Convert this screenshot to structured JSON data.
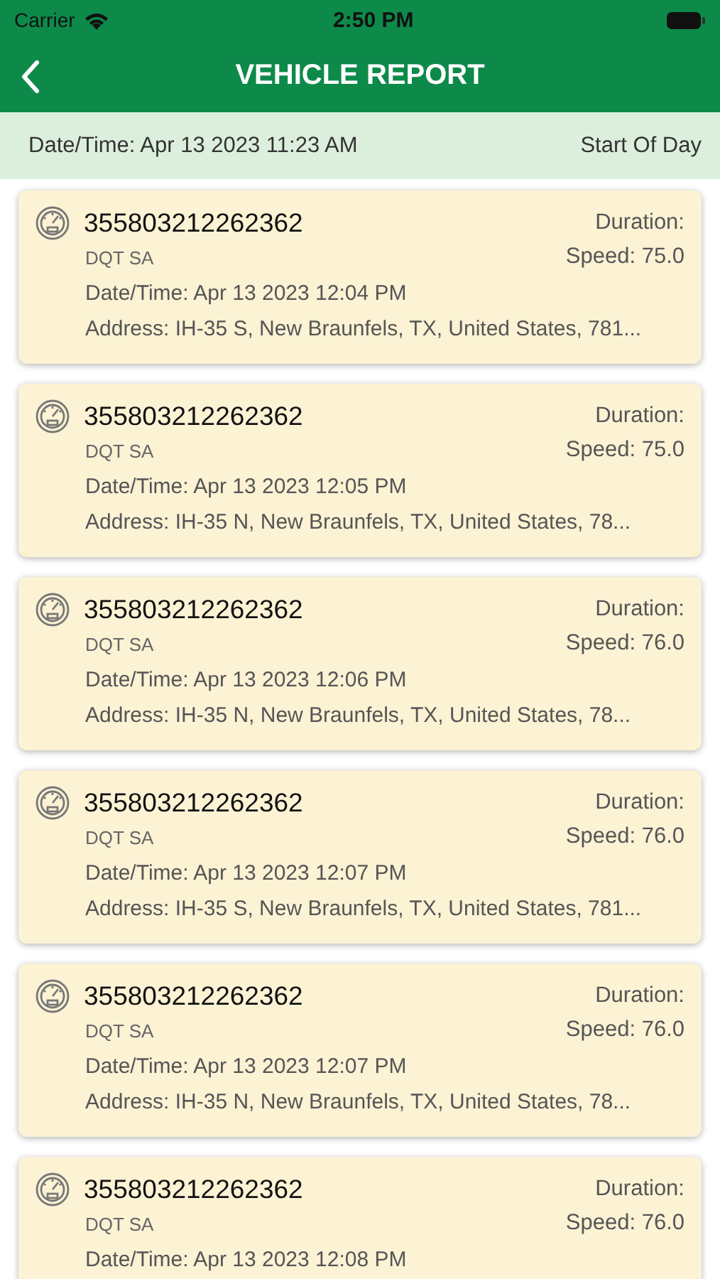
{
  "status_bar": {
    "carrier": "Carrier",
    "time": "2:50 PM"
  },
  "header": {
    "title": "VEHICLE REPORT"
  },
  "summary": {
    "datetime": "Date/Time: Apr 13 2023  11:23 AM",
    "event": "Start Of Day"
  },
  "reports": [
    {
      "device": "355803212262362",
      "company": "DQT SA",
      "duration": "Duration:",
      "speed": "Speed: 75.0",
      "datetime": "Date/Time: Apr 13 2023  12:04 PM",
      "address": "Address: IH-35 S, New Braunfels, TX, United States, 781..."
    },
    {
      "device": "355803212262362",
      "company": "DQT SA",
      "duration": "Duration:",
      "speed": "Speed: 75.0",
      "datetime": "Date/Time: Apr 13 2023  12:05 PM",
      "address": "Address: IH-35 N, New Braunfels, TX, United States, 78..."
    },
    {
      "device": "355803212262362",
      "company": "DQT SA",
      "duration": "Duration:",
      "speed": "Speed: 76.0",
      "datetime": "Date/Time: Apr 13 2023  12:06 PM",
      "address": "Address: IH-35 N, New Braunfels, TX, United States, 78..."
    },
    {
      "device": "355803212262362",
      "company": "DQT SA",
      "duration": "Duration:",
      "speed": "Speed: 76.0",
      "datetime": "Date/Time: Apr 13 2023  12:07 PM",
      "address": "Address: IH-35 S, New Braunfels, TX, United States, 781..."
    },
    {
      "device": "355803212262362",
      "company": "DQT SA",
      "duration": "Duration:",
      "speed": "Speed: 76.0",
      "datetime": "Date/Time: Apr 13 2023  12:07 PM",
      "address": "Address: IH-35 N, New Braunfels, TX, United States, 78..."
    },
    {
      "device": "355803212262362",
      "company": "DQT SA",
      "duration": "Duration:",
      "speed": "Speed: 76.0",
      "datetime": "Date/Time: Apr 13 2023  12:08 PM"
    }
  ]
}
